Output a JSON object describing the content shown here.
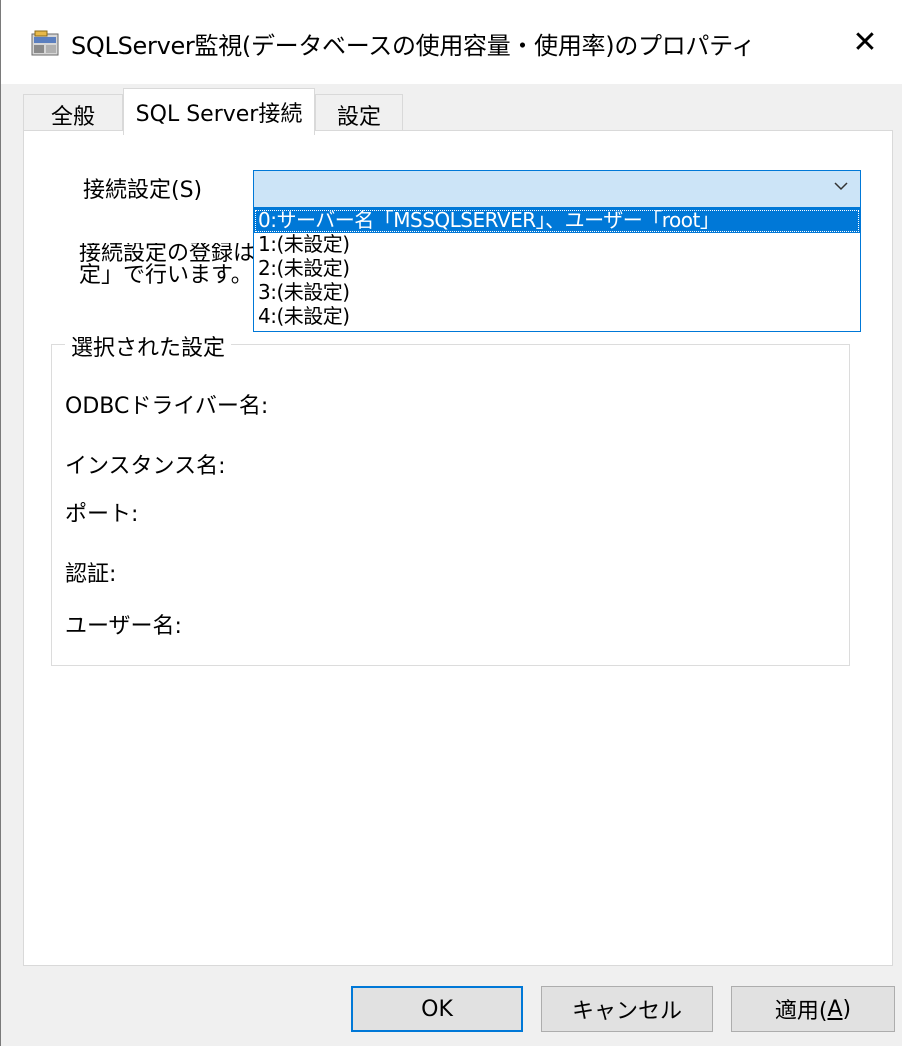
{
  "window": {
    "title": "SQLServer監視(データベースの使用容量・使用率)のプロパティ",
    "close_glyph": "✕"
  },
  "tabs": [
    {
      "label": "全般",
      "active": false
    },
    {
      "label": "SQL Server接続",
      "active": true
    },
    {
      "label": "設定",
      "active": false
    }
  ],
  "connection": {
    "label": "接続設定(S)",
    "selected_value": "",
    "options": [
      "0:サーバー名「MSSQLSERVER」、ユーザー「root」",
      "1:(未設定)",
      "2:(未設定)",
      "3:(未設定)",
      "4:(未設定)"
    ],
    "highlighted_index": 0
  },
  "info": {
    "line1": "接続設定の登録は",
    "line2": "定」で行います。"
  },
  "selected_settings": {
    "legend": "選択された設定",
    "fields": [
      {
        "label": "ODBCドライバー名:"
      },
      {
        "label": "インスタンス名:"
      },
      {
        "label": "ポート:"
      },
      {
        "label": "認証:"
      },
      {
        "label": "ユーザー名:"
      }
    ]
  },
  "buttons": {
    "ok": "OK",
    "cancel": "キャンセル",
    "apply_prefix": "適用(",
    "apply_key": "A",
    "apply_suffix": ")"
  },
  "colors": {
    "accent": "#0078d7",
    "select_bg": "#cce4f7",
    "dialog_bg": "#f0f0f0"
  }
}
